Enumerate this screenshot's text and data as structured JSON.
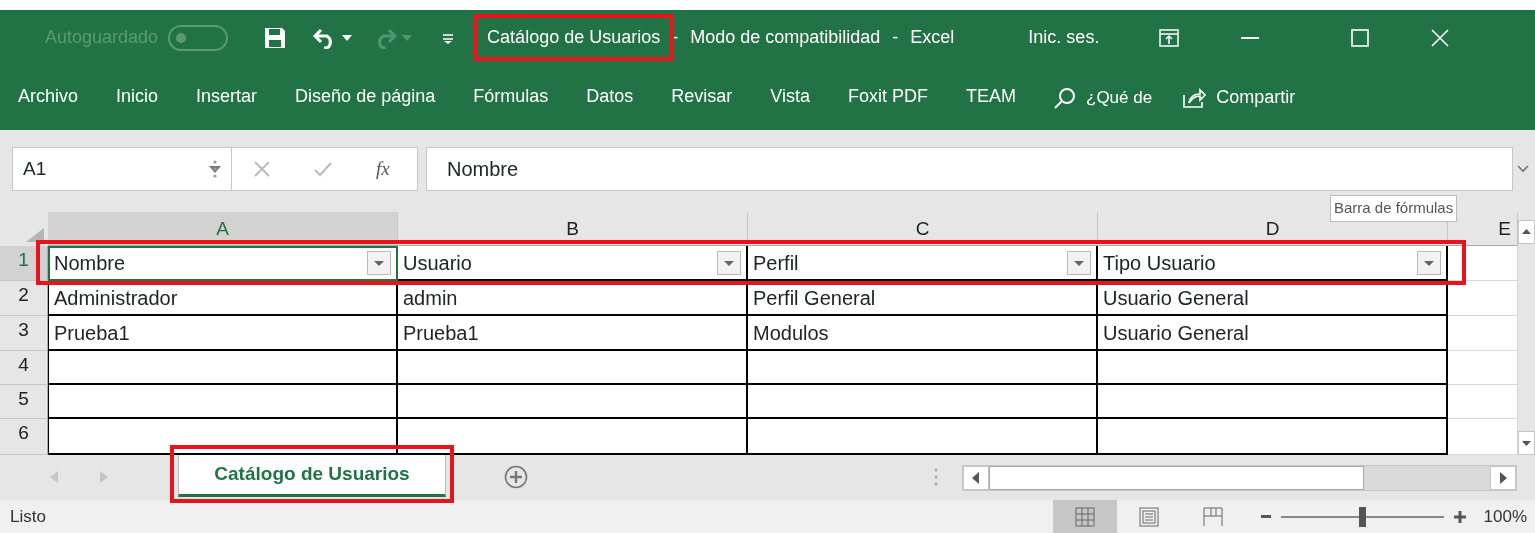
{
  "title_bar": {
    "autosave": {
      "label": "Autoguardado",
      "on": false
    },
    "title_segments": [
      "Catálogo de Usuarios",
      "-",
      "Modo de compatibilidad",
      "-",
      "Excel"
    ],
    "sign_in": "Inic. ses."
  },
  "ribbon": {
    "tabs": [
      {
        "label": "Archivo",
        "selected": false
      },
      {
        "label": "Inicio",
        "selected": false
      },
      {
        "label": "Insertar",
        "selected": false
      },
      {
        "label": "Diseño de página",
        "selected": false
      },
      {
        "label": "Fórmulas",
        "selected": false
      },
      {
        "label": "Datos",
        "selected": false
      },
      {
        "label": "Revisar",
        "selected": false
      },
      {
        "label": "Vista",
        "selected": false
      },
      {
        "label": "Foxit PDF",
        "selected": false
      },
      {
        "label": "TEAM",
        "selected": false
      }
    ],
    "tell_me": "¿Qué de",
    "share": "Compartir"
  },
  "formula_bar": {
    "name_box": "A1",
    "function_label": "fx",
    "value": "Nombre",
    "tooltip": "Barra de fórmulas"
  },
  "sheet": {
    "columns": [
      {
        "label": "A",
        "selected": true
      },
      {
        "label": "B",
        "selected": false
      },
      {
        "label": "C",
        "selected": false
      },
      {
        "label": "D",
        "selected": false
      },
      {
        "label": "E",
        "selected": false
      }
    ],
    "rows": [
      {
        "number": "1",
        "selected": true,
        "cells": [
          "Nombre",
          "Usuario",
          "Perfil",
          "Tipo Usuario"
        ],
        "filters": true
      },
      {
        "number": "2",
        "selected": false,
        "cells": [
          "Administrador",
          "admin",
          "Perfil General",
          "Usuario General"
        ],
        "filters": false
      },
      {
        "number": "3",
        "selected": false,
        "cells": [
          "Prueba1",
          "Prueba1",
          "Modulos",
          "Usuario General"
        ],
        "filters": false
      },
      {
        "number": "4",
        "selected": false,
        "cells": [],
        "filters": false
      },
      {
        "number": "5",
        "selected": false,
        "cells": [],
        "filters": false
      },
      {
        "number": "6",
        "selected": false,
        "cells": [],
        "filters": false
      }
    ]
  },
  "sheet_tabs": [
    {
      "label": "Catálogo de Usuarios",
      "selected": true
    }
  ],
  "status_bar": {
    "status": "Listo",
    "views": [
      {
        "kind": "normal",
        "selected": true
      },
      {
        "kind": "page-layout",
        "selected": false
      },
      {
        "kind": "page-break",
        "selected": false
      }
    ],
    "zoom": {
      "level": 0.5,
      "reading": "100%"
    }
  },
  "annotations": [
    {
      "kind": "title"
    },
    {
      "kind": "header-row"
    },
    {
      "kind": "sheet-tab"
    }
  ]
}
